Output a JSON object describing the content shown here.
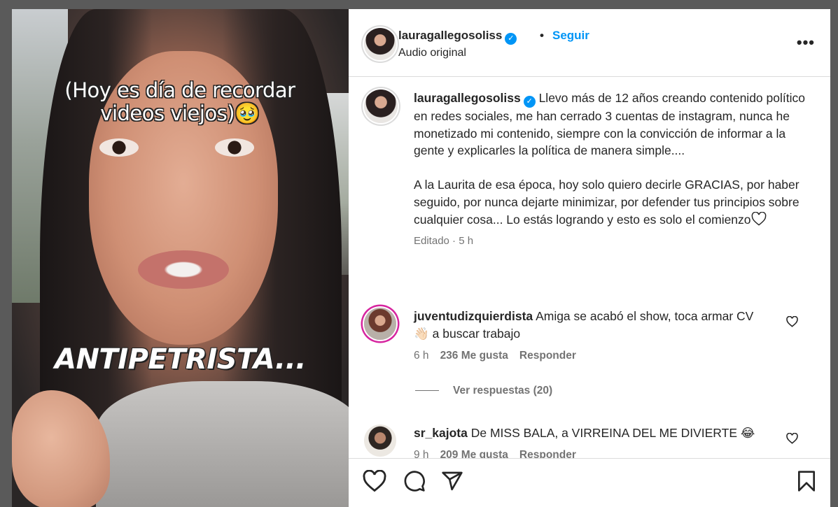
{
  "media": {
    "overlay_top": "(Hoy es día de recordar videos viejos)🥹",
    "overlay_bottom": "ANTIPETRISTA..."
  },
  "header": {
    "username": "lauragallegosoliss",
    "dot": "•",
    "follow_label": "Seguir",
    "audio": "Audio original",
    "more": "•••"
  },
  "caption": {
    "username": "lauragallegosoliss",
    "paragraph1": "Llevo más de 12 años creando contenido político en redes sociales, me han cerrado 3 cuentas de instagram, nunca he monetizado mi contenido, siempre con la convicción de informar a la gente y explicarles la política de manera simple....",
    "paragraph2": "A la Laurita de esa época, hoy solo quiero decirle GRACIAS, por haber seguido, por nunca dejarte minimizar, por defender tus principios sobre cualquier cosa... Lo estás logrando y esto es solo el comienzo",
    "meta": "Editado · 5 h"
  },
  "comments": [
    {
      "username": "juventudizquierdista",
      "text": "Amiga se acabó el show, toca armar CV 👋🏻 a buscar trabajo",
      "time": "6 h",
      "likes": "236 Me gusta",
      "reply": "Responder"
    },
    {
      "username": "sr_kajota",
      "text": "De MISS BALA, a VIRREINA DEL ME DIVIERTE 😂",
      "time": "9 h",
      "likes": "209 Me gusta",
      "reply": "Responder"
    }
  ],
  "view_replies": "Ver respuestas (20)",
  "icons": [
    "heart-icon",
    "comment-icon",
    "share-icon",
    "bookmark-icon",
    "more-icon"
  ]
}
